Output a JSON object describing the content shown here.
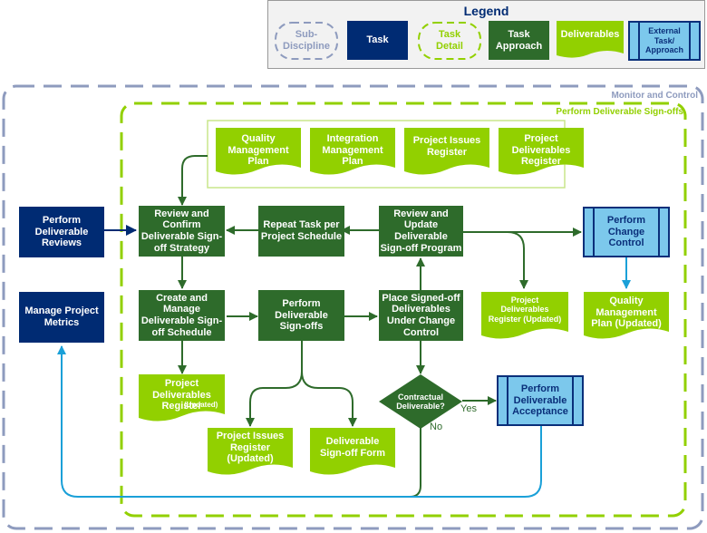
{
  "legend": {
    "title": "Legend",
    "items": [
      {
        "type": "sub-discipline",
        "label": "Sub-\nDiscipline"
      },
      {
        "type": "task",
        "label": "Task"
      },
      {
        "type": "task-detail",
        "label": "Task\nDetail"
      },
      {
        "type": "task-approach",
        "label": "Task\nApproach"
      },
      {
        "type": "deliverables",
        "label": "Deliverables"
      },
      {
        "type": "external",
        "label": "External\nTask/\nApproach"
      }
    ]
  },
  "colors": {
    "task": "#002B73",
    "approach": "#2E6B2B",
    "deliverable": "#92D000",
    "external_fill": "#7CC8EC",
    "external_border": "#0A2F7A",
    "sub_discipline_dash": "#8E9BBE",
    "task_detail_dash": "#92D000",
    "blue_connector": "#1AA0D8"
  },
  "groups": {
    "monitor_control": "Monitor and Control",
    "perform_signoffs": "Perform Deliverable Sign-offs"
  },
  "inputs": [
    {
      "label": "Quality\nManagement\nPlan"
    },
    {
      "label": "Integration\nManagement\nPlan"
    },
    {
      "label": "Project Issues\nRegister"
    },
    {
      "label": "Project\nDeliverables\nRegister"
    }
  ],
  "tasks": {
    "perform_reviews": "Perform\nDeliverable\nReviews",
    "manage_metrics": "Manage Project\nMetrics"
  },
  "approaches": {
    "review_confirm": "Review and\nConfirm\nDeliverable Sign-\noff Strategy",
    "repeat_task": "Repeat Task per\nProject Schedule",
    "review_update": "Review and\nUpdate\nDeliverable\nSign-off Program",
    "create_manage": "Create and\nManage\nDeliverable Sign-\noff Schedule",
    "perform_signoffs": "Perform\nDeliverable\nSign-offs",
    "place_signed": "Place Signed-off\nDeliverables\nUnder Change\nControl"
  },
  "decision": {
    "label": "Contractual\nDeliverable?",
    "yes": "Yes",
    "no": "No"
  },
  "external": {
    "change_control": "Perform\nChange\nControl",
    "acceptance": "Perform\nDeliverable\nAcceptance"
  },
  "outputs": {
    "pdr_updated_right": "Project\nDeliverables\nRegister (Updated)",
    "qmp_updated": "Quality\nManagement\nPlan (Updated)",
    "pdr_updated_left_main": "Project\nDeliverables\nRegister",
    "pdr_updated_left_suffix": "(Updated)",
    "pir_updated": "Project Issues\nRegister\n(Updated)",
    "signoff_form": "Deliverable\nSign-off Form"
  }
}
